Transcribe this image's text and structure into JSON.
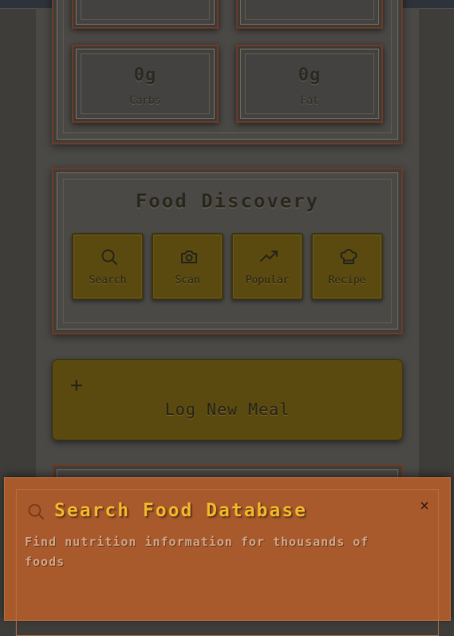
{
  "nutrients": {
    "carbs": {
      "value": "0g",
      "label": "Carbs"
    },
    "fat": {
      "value": "0g",
      "label": "Fat"
    }
  },
  "discovery": {
    "title": "Food Discovery",
    "buttons": [
      {
        "label": "Search",
        "icon": "search-icon"
      },
      {
        "label": "Scan",
        "icon": "camera-icon"
      },
      {
        "label": "Popular",
        "icon": "trending-up-icon"
      },
      {
        "label": "Recipe",
        "icon": "chef-hat-icon"
      }
    ]
  },
  "log_meal": {
    "plus": "+",
    "label": "Log New Meal"
  },
  "search_sheet": {
    "title": "Search Food Database",
    "description": "Find nutrition information for thousands of foods",
    "close": "×"
  }
}
